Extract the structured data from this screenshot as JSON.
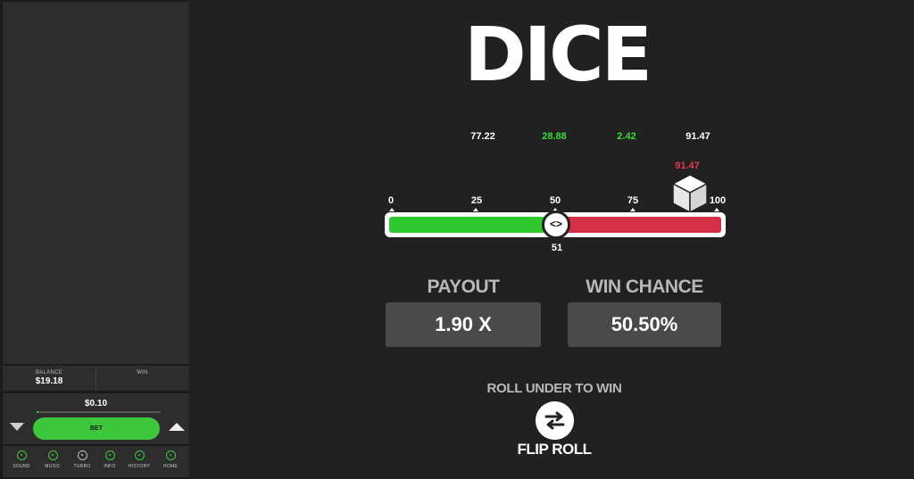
{
  "title": "DICE",
  "recent_rolls": [
    {
      "value": "77.22",
      "color": "#ffffff"
    },
    {
      "value": "28.88",
      "color": "#3dd93d"
    },
    {
      "value": "2.42",
      "color": "#3dd93d"
    },
    {
      "value": "91.47",
      "color": "#ffffff"
    }
  ],
  "last_roll": {
    "value": "91.47",
    "color": "#e23a52",
    "position": 91.47
  },
  "scale": {
    "ticks": [
      "0",
      "25",
      "50",
      "75",
      "100"
    ],
    "min": 0,
    "max": 100
  },
  "threshold": {
    "value": 51,
    "label": "51",
    "handle_glyph": "<>"
  },
  "colors": {
    "win": "#30c830",
    "lose": "#d32f47",
    "accent": "#3dc73d"
  },
  "payout": {
    "label": "PAYOUT",
    "value": "1.90 X"
  },
  "win_chance": {
    "label": "WIN CHANCE",
    "value": "50.50%"
  },
  "roll_mode": {
    "label": "ROLL UNDER TO WIN",
    "button": "FLIP ROLL",
    "icon": "swap-arrows-icon"
  },
  "sidebar": {
    "balance_label": "BALANCE",
    "balance_value": "$19.18",
    "win_label": "WIN",
    "win_value": "",
    "bet_amount": "$0.10",
    "bet_button": "BET",
    "menu": [
      {
        "label": "SOUND",
        "icon": "sound-icon",
        "active": true
      },
      {
        "label": "MUSIC",
        "icon": "music-icon",
        "active": true
      },
      {
        "label": "TURBO",
        "icon": "turbo-icon",
        "active": false
      },
      {
        "label": "INFO",
        "icon": "info-icon",
        "active": true
      },
      {
        "label": "HISTORY",
        "icon": "history-icon",
        "active": true
      },
      {
        "label": "HOME",
        "icon": "home-icon",
        "active": true
      }
    ]
  }
}
